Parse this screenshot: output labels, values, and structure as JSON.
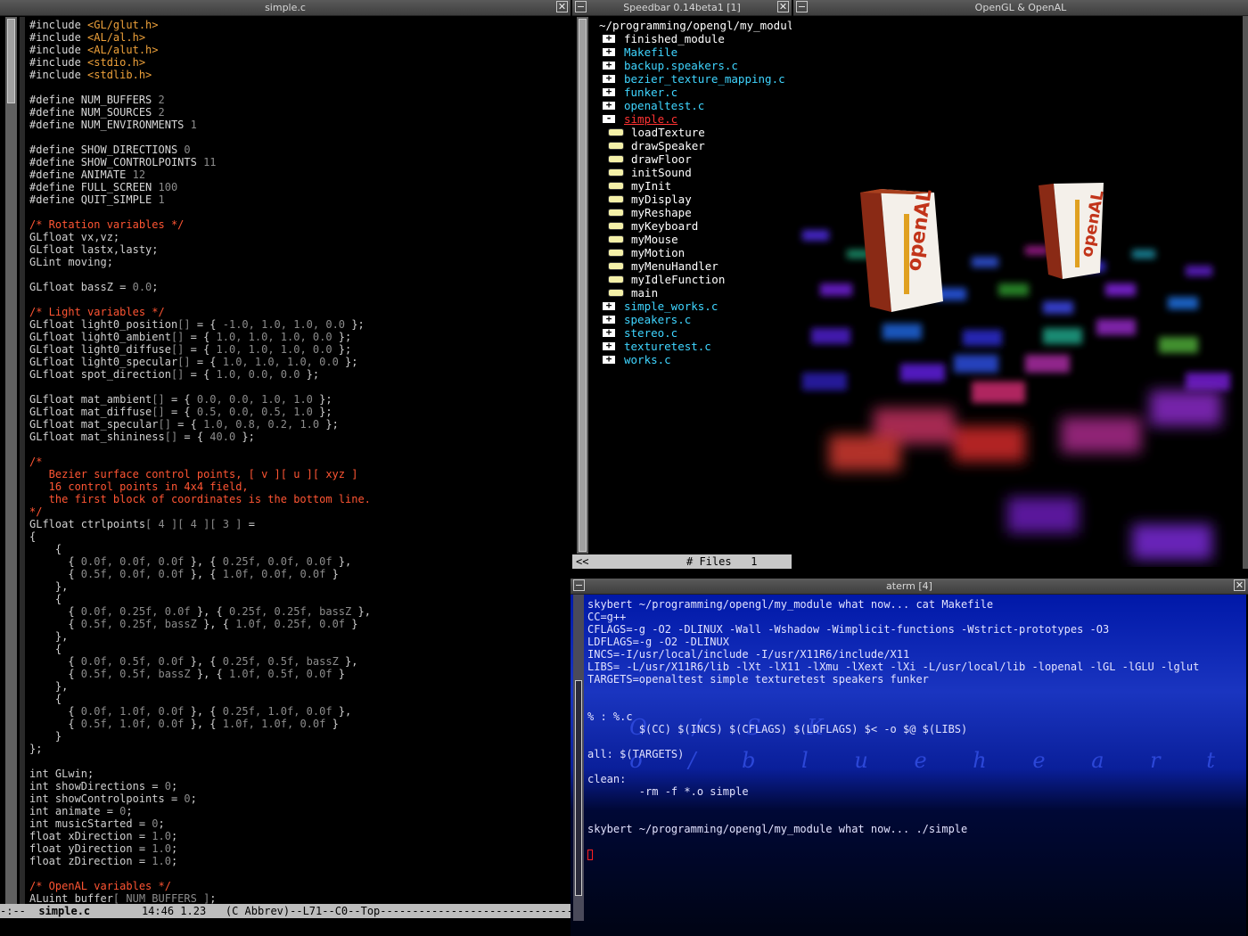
{
  "editor": {
    "title": "simple.c",
    "code_lines": [
      [
        [
          "pp",
          "#include "
        ],
        [
          "inc",
          "<GL/glut.h>"
        ]
      ],
      [
        [
          "pp",
          "#include "
        ],
        [
          "inc",
          "<AL/al.h>"
        ]
      ],
      [
        [
          "pp",
          "#include "
        ],
        [
          "inc",
          "<AL/alut.h>"
        ]
      ],
      [
        [
          "pp",
          "#include "
        ],
        [
          "inc",
          "<stdio.h>"
        ]
      ],
      [
        [
          "pp",
          "#include "
        ],
        [
          "inc",
          "<stdlib.h>"
        ]
      ],
      [],
      [
        [
          "pp",
          "#define NUM_BUFFERS "
        ],
        [
          "num",
          "2"
        ]
      ],
      [
        [
          "pp",
          "#define NUM_SOURCES "
        ],
        [
          "num",
          "2"
        ]
      ],
      [
        [
          "pp",
          "#define NUM_ENVIRONMENTS "
        ],
        [
          "num",
          "1"
        ]
      ],
      [],
      [
        [
          "pp",
          "#define SHOW_DIRECTIONS "
        ],
        [
          "num",
          "0"
        ]
      ],
      [
        [
          "pp",
          "#define SHOW_CONTROLPOINTS "
        ],
        [
          "num",
          "11"
        ]
      ],
      [
        [
          "pp",
          "#define ANIMATE "
        ],
        [
          "num",
          "12"
        ]
      ],
      [
        [
          "pp",
          "#define FULL_SCREEN "
        ],
        [
          "num",
          "100"
        ]
      ],
      [
        [
          "pp",
          "#define QUIT_SIMPLE "
        ],
        [
          "num",
          "1"
        ]
      ],
      [],
      [
        [
          "cm",
          "/* Rotation variables */"
        ]
      ],
      [
        [
          "tx",
          "GLfloat vx,vz;"
        ]
      ],
      [
        [
          "tx",
          "GLfloat lastx,lasty;"
        ]
      ],
      [
        [
          "tx",
          "GLint moving;"
        ]
      ],
      [],
      [
        [
          "tx",
          "GLfloat bassZ = "
        ],
        [
          "num",
          "0.0"
        ],
        [
          "tx",
          ";"
        ]
      ],
      [],
      [
        [
          "cm",
          "/* Light variables */"
        ]
      ],
      [
        [
          "tx",
          "GLfloat light0_position"
        ],
        [
          "br",
          "[]"
        ],
        [
          "tx",
          " = { "
        ],
        [
          "num",
          "-1.0, 1.0, 1.0, 0.0"
        ],
        [
          "tx",
          " };"
        ]
      ],
      [
        [
          "tx",
          "GLfloat light0_ambient"
        ],
        [
          "br",
          "[]"
        ],
        [
          "tx",
          " = { "
        ],
        [
          "num",
          "1.0, 1.0, 1.0, 0.0"
        ],
        [
          "tx",
          " };"
        ]
      ],
      [
        [
          "tx",
          "GLfloat light0_diffuse"
        ],
        [
          "br",
          "[]"
        ],
        [
          "tx",
          " = { "
        ],
        [
          "num",
          "1.0, 1.0, 1.0, 0.0"
        ],
        [
          "tx",
          " };"
        ]
      ],
      [
        [
          "tx",
          "GLfloat light0_specular"
        ],
        [
          "br",
          "[]"
        ],
        [
          "tx",
          " = { "
        ],
        [
          "num",
          "1.0, 1.0, 1.0, 0.0"
        ],
        [
          "tx",
          " };"
        ]
      ],
      [
        [
          "tx",
          "GLfloat spot_direction"
        ],
        [
          "br",
          "[]"
        ],
        [
          "tx",
          " = { "
        ],
        [
          "num",
          "1.0, 0.0, 0.0"
        ],
        [
          "tx",
          " };"
        ]
      ],
      [],
      [
        [
          "tx",
          "GLfloat mat_ambient"
        ],
        [
          "br",
          "[]"
        ],
        [
          "tx",
          " = { "
        ],
        [
          "num",
          "0.0, 0.0, 1.0, 1.0"
        ],
        [
          "tx",
          " };"
        ]
      ],
      [
        [
          "tx",
          "GLfloat mat_diffuse"
        ],
        [
          "br",
          "[]"
        ],
        [
          "tx",
          " = { "
        ],
        [
          "num",
          "0.5, 0.0, 0.5, 1.0"
        ],
        [
          "tx",
          " };"
        ]
      ],
      [
        [
          "tx",
          "GLfloat mat_specular"
        ],
        [
          "br",
          "[]"
        ],
        [
          "tx",
          " = { "
        ],
        [
          "num",
          "1.0, 0.8, 0.2, 1.0"
        ],
        [
          "tx",
          " };"
        ]
      ],
      [
        [
          "tx",
          "GLfloat mat_shininess"
        ],
        [
          "br",
          "[]"
        ],
        [
          "tx",
          " = { "
        ],
        [
          "num",
          "40.0"
        ],
        [
          "tx",
          " };"
        ]
      ],
      [],
      [
        [
          "cm",
          "/*"
        ]
      ],
      [
        [
          "cm",
          "   Bezier surface control points, [ v ][ u ][ xyz ]"
        ]
      ],
      [
        [
          "cm",
          "   16 control points in 4x4 field,"
        ]
      ],
      [
        [
          "cm",
          "   the first block of coordinates is the bottom line."
        ]
      ],
      [
        [
          "cm",
          "*/"
        ]
      ],
      [
        [
          "tx",
          "GLfloat ctrlpoints"
        ],
        [
          "br",
          "[ "
        ],
        [
          "num",
          "4"
        ],
        [
          "br",
          " ][ "
        ],
        [
          "num",
          "4"
        ],
        [
          "br",
          " ][ "
        ],
        [
          "num",
          "3"
        ],
        [
          "br",
          " ]"
        ],
        [
          "tx",
          " ="
        ]
      ],
      [
        [
          "tx",
          "{"
        ]
      ],
      [
        [
          "tx",
          "    {"
        ]
      ],
      [
        [
          "tx",
          "      { "
        ],
        [
          "num",
          "0.0f, 0.0f, 0.0f"
        ],
        [
          "tx",
          " }, { "
        ],
        [
          "num",
          "0.25f, 0.0f, 0.0f"
        ],
        [
          "tx",
          " },"
        ]
      ],
      [
        [
          "tx",
          "      { "
        ],
        [
          "num",
          "0.5f, 0.0f, 0.0f"
        ],
        [
          "tx",
          " }, { "
        ],
        [
          "num",
          "1.0f, 0.0f, 0.0f"
        ],
        [
          "tx",
          " }"
        ]
      ],
      [
        [
          "tx",
          "    },"
        ]
      ],
      [
        [
          "tx",
          "    {"
        ]
      ],
      [
        [
          "tx",
          "      { "
        ],
        [
          "num",
          "0.0f, 0.25f, 0.0f"
        ],
        [
          "tx",
          " }, { "
        ],
        [
          "num",
          "0.25f, 0.25f, bassZ"
        ],
        [
          "tx",
          " },"
        ]
      ],
      [
        [
          "tx",
          "      { "
        ],
        [
          "num",
          "0.5f, 0.25f, bassZ"
        ],
        [
          "tx",
          " }, { "
        ],
        [
          "num",
          "1.0f, 0.25f, 0.0f"
        ],
        [
          "tx",
          " }"
        ]
      ],
      [
        [
          "tx",
          "    },"
        ]
      ],
      [
        [
          "tx",
          "    {"
        ]
      ],
      [
        [
          "tx",
          "      { "
        ],
        [
          "num",
          "0.0f, 0.5f, 0.0f"
        ],
        [
          "tx",
          " }, { "
        ],
        [
          "num",
          "0.25f, 0.5f, bassZ"
        ],
        [
          "tx",
          " },"
        ]
      ],
      [
        [
          "tx",
          "      { "
        ],
        [
          "num",
          "0.5f, 0.5f, bassZ"
        ],
        [
          "tx",
          " }, { "
        ],
        [
          "num",
          "1.0f, 0.5f, 0.0f"
        ],
        [
          "tx",
          " }"
        ]
      ],
      [
        [
          "tx",
          "    },"
        ]
      ],
      [
        [
          "tx",
          "    {"
        ]
      ],
      [
        [
          "tx",
          "      { "
        ],
        [
          "num",
          "0.0f, 1.0f, 0.0f"
        ],
        [
          "tx",
          " }, { "
        ],
        [
          "num",
          "0.25f, 1.0f, 0.0f"
        ],
        [
          "tx",
          " },"
        ]
      ],
      [
        [
          "tx",
          "      { "
        ],
        [
          "num",
          "0.5f, 1.0f, 0.0f"
        ],
        [
          "tx",
          " }, { "
        ],
        [
          "num",
          "1.0f, 1.0f, 0.0f"
        ],
        [
          "tx",
          " }"
        ]
      ],
      [
        [
          "tx",
          "    }"
        ]
      ],
      [
        [
          "tx",
          "};"
        ]
      ],
      [],
      [
        [
          "tx",
          "int GLwin;"
        ]
      ],
      [
        [
          "tx",
          "int showDirections = "
        ],
        [
          "num",
          "0"
        ],
        [
          "tx",
          ";"
        ]
      ],
      [
        [
          "tx",
          "int showControlpoints = "
        ],
        [
          "num",
          "0"
        ],
        [
          "tx",
          ";"
        ]
      ],
      [
        [
          "tx",
          "int animate = "
        ],
        [
          "num",
          "0"
        ],
        [
          "tx",
          ";"
        ]
      ],
      [
        [
          "tx",
          "int musicStarted = "
        ],
        [
          "num",
          "0"
        ],
        [
          "tx",
          ";"
        ]
      ],
      [
        [
          "tx",
          "float xDirection = "
        ],
        [
          "num",
          "1.0"
        ],
        [
          "tx",
          ";"
        ]
      ],
      [
        [
          "tx",
          "float yDirection = "
        ],
        [
          "num",
          "1.0"
        ],
        [
          "tx",
          ";"
        ]
      ],
      [
        [
          "tx",
          "float zDirection = "
        ],
        [
          "num",
          "1.0"
        ],
        [
          "tx",
          ";"
        ]
      ],
      [],
      [
        [
          "cm",
          "/* OpenAL variables */"
        ]
      ],
      [
        [
          "tx",
          "ALuint buffer"
        ],
        [
          "br",
          "[ NUM_BUFFERS ]"
        ],
        [
          "tx",
          ";"
        ]
      ]
    ],
    "modeline": {
      "prefix": "-:--  ",
      "buffer": "simple.c",
      "rest": "        14:46 1.23   (C Abbrev)--L71--C0--Top-------------------------------------"
    }
  },
  "speedbar": {
    "title": "Speedbar 0.14beta1 [1]",
    "path": "~/programming/opengl/my_modul",
    "items": [
      {
        "kind": "dir-plus",
        "label": "finished_module",
        "color": "#ffffff"
      },
      {
        "kind": "file-plus",
        "label": "Makefile",
        "color": "#3fd5ff"
      },
      {
        "kind": "file-plus",
        "label": "backup.speakers.c",
        "color": "#3fd5ff"
      },
      {
        "kind": "file-plus",
        "label": "bezier_texture_mapping.c",
        "color": "#3fd5ff"
      },
      {
        "kind": "file-plus",
        "label": "funker.c",
        "color": "#3fd5ff"
      },
      {
        "kind": "file-plus",
        "label": "openaltest.c",
        "color": "#3fd5ff"
      },
      {
        "kind": "file-minus",
        "label": "simple.c",
        "color": "#ff3333"
      },
      {
        "kind": "tag",
        "label": "loadTexture",
        "color": "#ffffff"
      },
      {
        "kind": "tag",
        "label": "drawSpeaker",
        "color": "#ffffff"
      },
      {
        "kind": "tag",
        "label": "drawFloor",
        "color": "#ffffff"
      },
      {
        "kind": "tag",
        "label": "initSound",
        "color": "#ffffff"
      },
      {
        "kind": "tag",
        "label": "myInit",
        "color": "#ffffff"
      },
      {
        "kind": "tag",
        "label": "myDisplay",
        "color": "#ffffff"
      },
      {
        "kind": "tag",
        "label": "myReshape",
        "color": "#ffffff"
      },
      {
        "kind": "tag",
        "label": "myKeyboard",
        "color": "#ffffff"
      },
      {
        "kind": "tag",
        "label": "myMouse",
        "color": "#ffffff"
      },
      {
        "kind": "tag",
        "label": "myMotion",
        "color": "#ffffff"
      },
      {
        "kind": "tag",
        "label": "myMenuHandler",
        "color": "#ffffff"
      },
      {
        "kind": "tag",
        "label": "myIdleFunction",
        "color": "#ffffff"
      },
      {
        "kind": "tag",
        "label": "main",
        "color": "#ffffff"
      },
      {
        "kind": "file-plus",
        "label": "simple_works.c",
        "color": "#3fd5ff"
      },
      {
        "kind": "file-plus",
        "label": "speakers.c",
        "color": "#3fd5ff"
      },
      {
        "kind": "file-plus",
        "label": "stereo.c",
        "color": "#3fd5ff"
      },
      {
        "kind": "file-plus",
        "label": "texturetest.c",
        "color": "#3fd5ff"
      },
      {
        "kind": "file-plus",
        "label": "works.c",
        "color": "#3fd5ff"
      }
    ],
    "status_left": "<<",
    "status": "# Files   1"
  },
  "opengl": {
    "title": "OpenGL & OpenAL",
    "speaker_logo": "openAL"
  },
  "aterm": {
    "title": "aterm [4]",
    "lines": [
      {
        "text": "skybert ~/programming/opengl/my_module what now... cat Makefile",
        "color": "#e3e3ff"
      },
      {
        "text": "CC=g++",
        "color": "#e3e3ff"
      },
      {
        "text": "CFLAGS=-g -O2 -DLINUX -Wall -Wshadow -Wimplicit-functions -Wstrict-prototypes -O3",
        "color": "#e3e3ff"
      },
      {
        "text": "LDFLAGS=-g -O2 -DLINUX",
        "color": "#e3e3ff"
      },
      {
        "text": "INCS=-I/usr/local/include -I/usr/X11R6/include/X11",
        "color": "#e3e3ff"
      },
      {
        "text": "LIBS= -L/usr/X11R6/lib -lXt -lX11 -lXmu -lXext -lXi -L/usr/local/lib -lopenal -lGL -lGLU -lglut",
        "color": "#e3e3ff"
      },
      {
        "text": "TARGETS=openaltest simple texturetest speakers funker",
        "color": "#e3e3ff"
      },
      {
        "text": "",
        "color": "#e3e3ff"
      },
      {
        "text": "",
        "color": "#e3e3ff"
      },
      {
        "text": "% : %.c",
        "color": "#e3e3ff"
      },
      {
        "text": "        $(CC) $(INCS) $(CFLAGS) $(LDFLAGS) $< -o $@ $(LIBS)",
        "color": "#e3e3ff"
      },
      {
        "text": "",
        "color": "#e3e3ff"
      },
      {
        "text": "all: $(TARGETS)",
        "color": "#e3e3ff"
      },
      {
        "text": "",
        "color": "#e3e3ff"
      },
      {
        "text": "clean:",
        "color": "#e3e3ff"
      },
      {
        "text": "        -rm -f *.o simple",
        "color": "#e3e3ff"
      },
      {
        "text": "",
        "color": "#e3e3ff"
      },
      {
        "text": "",
        "color": "#e3e3ff"
      },
      {
        "text": "skybert ~/programming/opengl/my_module what now... ./simple",
        "color": "#e3e3ff"
      }
    ],
    "wallpaper_text_1": "I O / S K",
    "wallpaper_text_2": "t o / b l u e h e a r t /"
  },
  "colors": {
    "code_text": "#d0d0d0",
    "comment": "#ff5533",
    "include": "#eea13a",
    "speaker_box": "#8a2a15"
  }
}
